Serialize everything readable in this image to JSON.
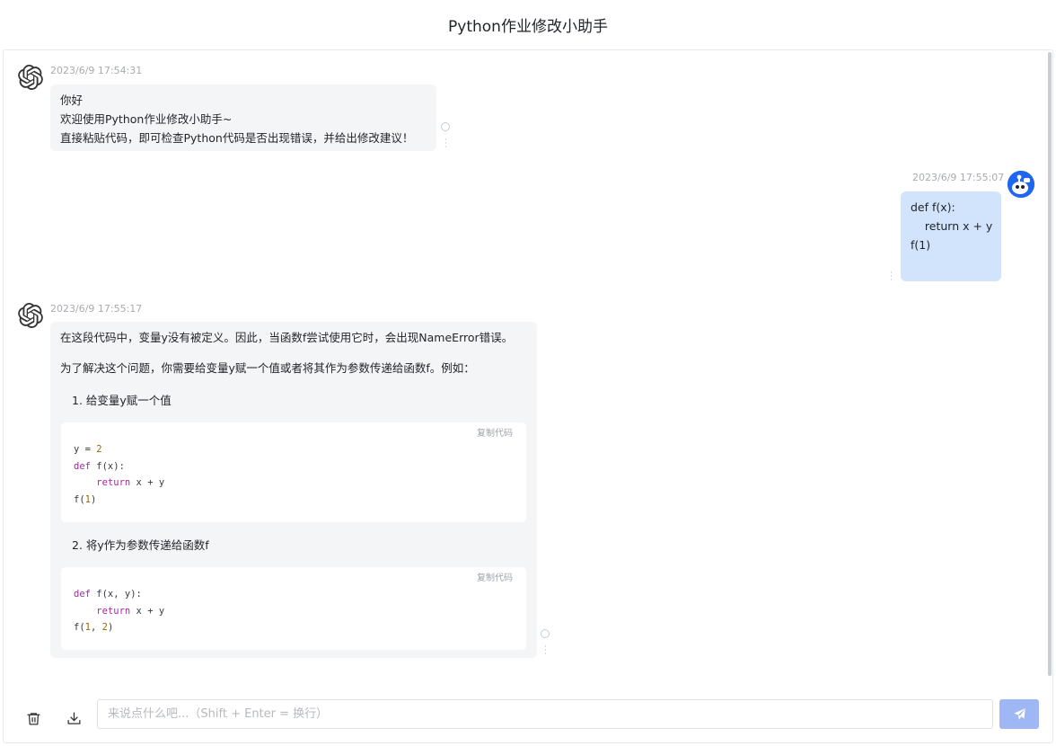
{
  "app": {
    "title": "Python作业修改小助手"
  },
  "messages": [
    {
      "role": "bot",
      "timestamp": "2023/6/9 17:54:31",
      "lines": [
        "你好",
        "欢迎使用Python作业修改小助手~",
        "直接粘贴代码，即可检查Python代码是否出现错误，并给出修改建议！"
      ]
    },
    {
      "role": "user",
      "timestamp": "2023/6/9 17:55:07",
      "lines": [
        "def f(x):",
        "    return x + y",
        "",
        "f(1)"
      ]
    },
    {
      "role": "bot",
      "timestamp": "2023/6/9 17:55:17",
      "paragraph1": "在这段代码中，变量y没有被定义。因此，当函数f尝试使用它时，会出现NameError错误。",
      "paragraph2": "为了解决这个问题，你需要给变量y赋一个值或者将其作为参数传递给函数f。例如：",
      "item1": "1. 给变量y赋一个值",
      "item2": "2. 将y作为参数传递给函数f",
      "copy_label": "复制代码"
    }
  ],
  "input": {
    "placeholder": "来说点什么吧...（Shift + Enter = 换行）",
    "value": ""
  },
  "icons": {
    "bot_avatar": "openai-logo-icon",
    "user_avatar": "robot-avatar-icon",
    "clear": "trash-icon",
    "export": "download-icon",
    "send": "send-icon"
  }
}
